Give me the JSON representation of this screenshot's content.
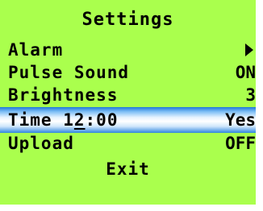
{
  "title": "Settings",
  "menu": {
    "alarm": {
      "label": "Alarm",
      "icon": "right-arrow-icon"
    },
    "pulse_sound": {
      "label": "Pulse Sound",
      "value": "ON"
    },
    "brightness": {
      "label": "Brightness",
      "value": "3"
    },
    "time": {
      "prefix": "Time ",
      "hour_first_digit": "1",
      "hour_second_digit": "2",
      "rest": ":00",
      "value": "Yes"
    },
    "upload": {
      "label": "Upload",
      "value": "OFF"
    }
  },
  "exit_label": "Exit",
  "colors": {
    "screen_background": "#aaff4d",
    "selection_highlight": "#1e78d8",
    "text": "#000000"
  }
}
